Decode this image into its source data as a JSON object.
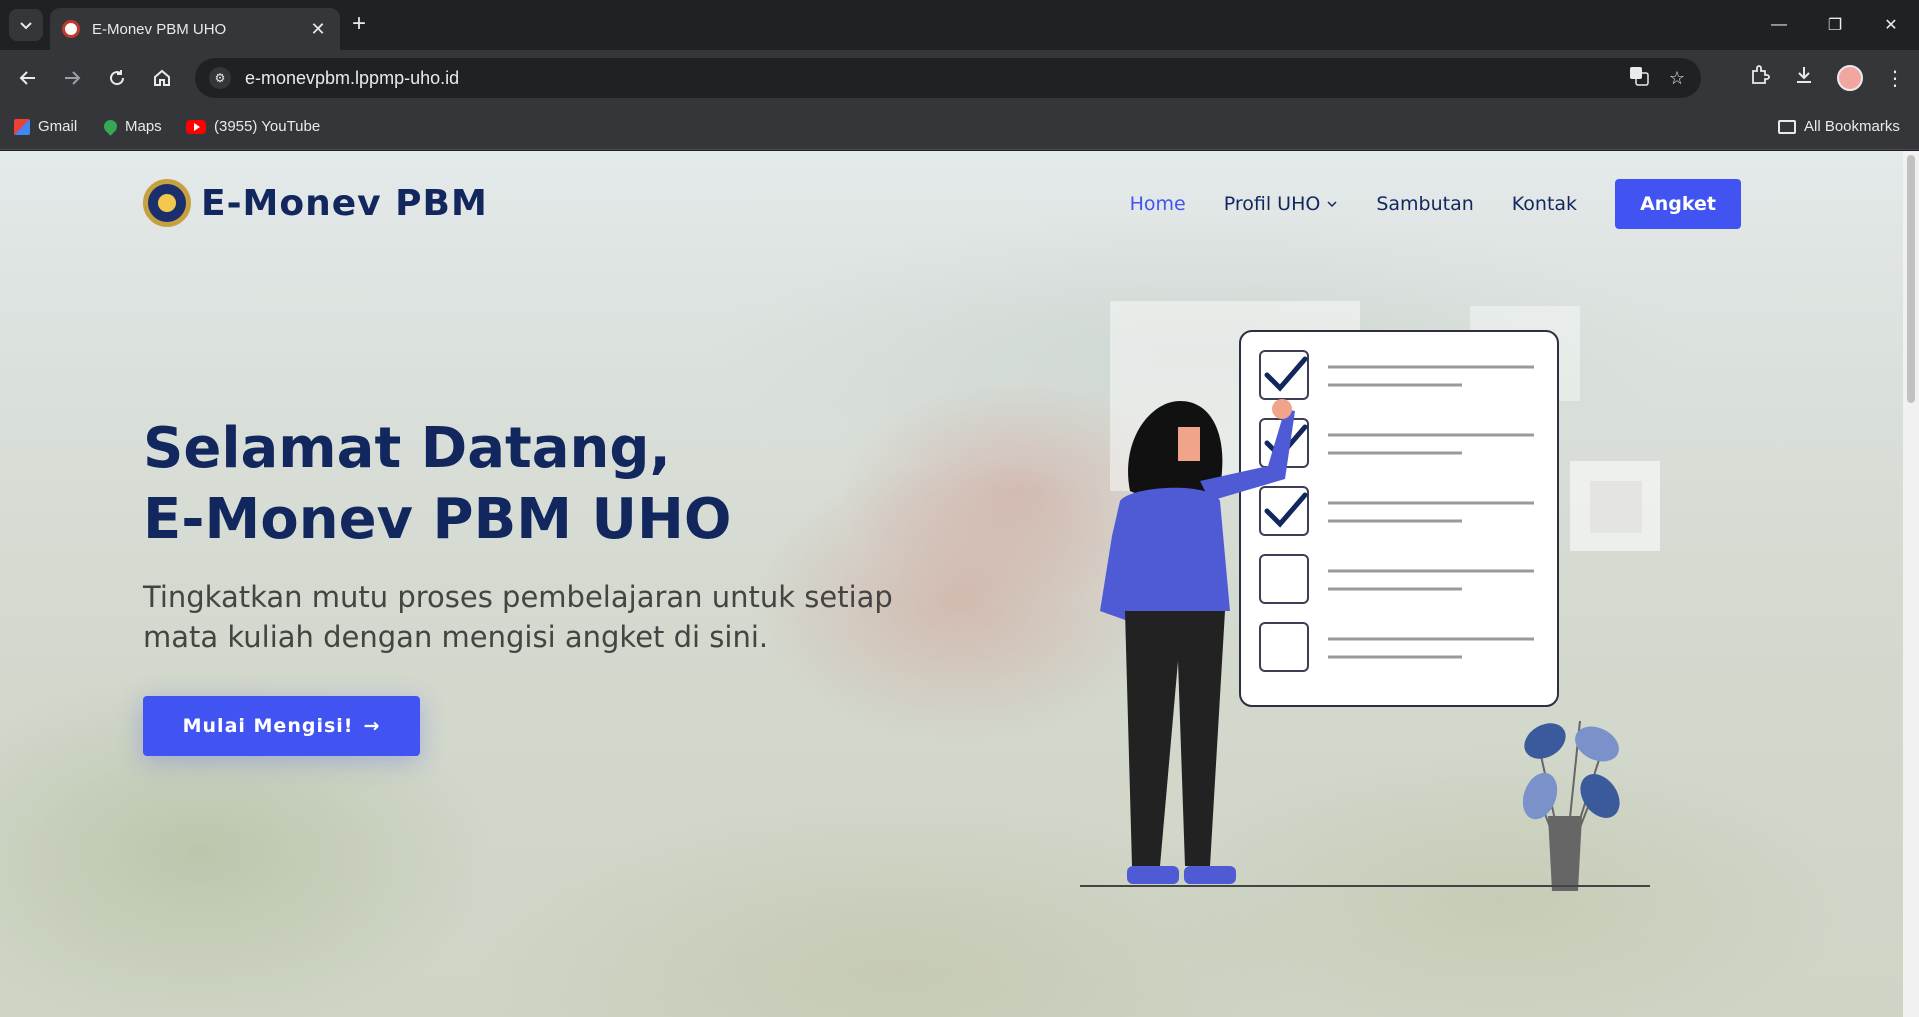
{
  "browser": {
    "tab_title": "E-Monev PBM UHO",
    "url": "e-monevpbm.lppmp-uho.id",
    "bookmarks": [
      "Gmail",
      "Maps",
      "(3955) YouTube"
    ],
    "all_bookmarks": "All Bookmarks"
  },
  "site": {
    "brand": "E-Monev PBM",
    "nav": {
      "home": "Home",
      "profil": "Profil UHO",
      "sambutan": "Sambutan",
      "kontak": "Kontak",
      "angket": "Angket"
    },
    "hero": {
      "title_line1": "Selamat Datang,",
      "title_line2": "E-Monev PBM UHO",
      "subtitle": "Tingkatkan mutu proses pembelajaran untuk setiap mata kuliah dengan mengisi angket di sini.",
      "cta": "Mulai Mengisi!",
      "cta_arrow": "→"
    }
  },
  "colors": {
    "accent": "#4154f1",
    "navy": "#12275e"
  },
  "icons": {
    "back": "arrow-left",
    "forward": "arrow-right",
    "reload": "reload",
    "home": "home",
    "translate": "translate",
    "star": "star",
    "extensions": "puzzle",
    "download": "download",
    "menu": "kebab"
  }
}
